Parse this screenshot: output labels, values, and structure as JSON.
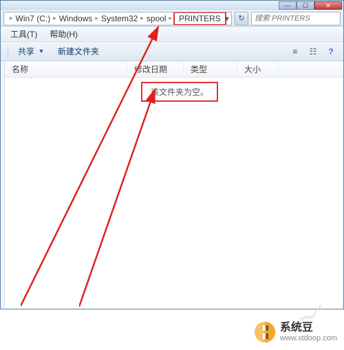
{
  "window": {
    "min_glyph": "—",
    "max_glyph": "☐",
    "close_glyph": "✕"
  },
  "breadcrumb": {
    "items": [
      "Win7 (C:)",
      "Windows",
      "System32",
      "spool",
      "PRINTERS"
    ],
    "sep": "▸",
    "dropdown_glyph": "▾",
    "refresh_glyph": "↻"
  },
  "search": {
    "placeholder": "搜索 PRINTERS"
  },
  "menubar": {
    "tools": "工具(T)",
    "help": "帮助(H)"
  },
  "toolbar": {
    "share": "共享",
    "new_folder": "新建文件夹",
    "view_icon1": "≡",
    "view_icon2": "☷",
    "help_icon": "?"
  },
  "columns": {
    "name": "名称",
    "date": "修改日期",
    "type": "类型",
    "size": "大小"
  },
  "content": {
    "empty_message": "该文件夹为空。"
  },
  "watermark": {
    "title": "系统豆",
    "url": "www.xtdoop.com"
  }
}
